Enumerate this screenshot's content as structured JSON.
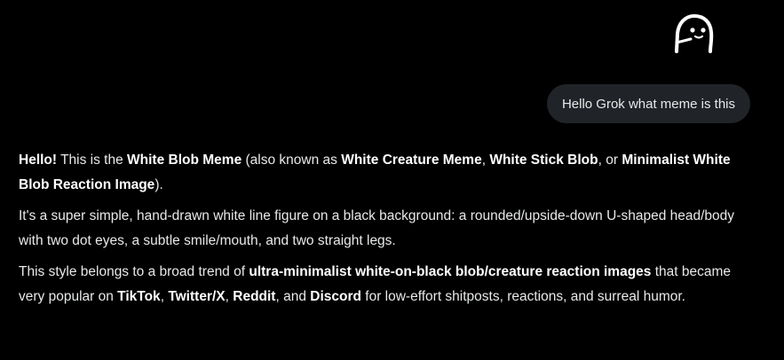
{
  "user": {
    "image": {
      "icon": "white-blob-creature-meme-icon"
    },
    "message": "Hello Grok what meme is this"
  },
  "assistant": {
    "p1": {
      "s1": "Hello!",
      "s2": " This is the ",
      "s3": "White Blob Meme",
      "s4": " (also known as ",
      "s5": "White Creature Meme",
      "s6": ", ",
      "s7": "White Stick Blob",
      "s8": ", or ",
      "s9": "Minimalist White Blob Reaction Image",
      "s10": ")."
    },
    "p2": "It's a super simple, hand-drawn white line figure on a black background: a rounded/upside-down U-shaped head/body with two dot eyes, a subtle smile/mouth, and two straight legs.",
    "p3": {
      "s1": "This style belongs to a broad trend of ",
      "s2": "ultra-minimalist white-on-black blob/creature reaction images",
      "s3": " that became very popular on ",
      "s4": "TikTok",
      "s5": ", ",
      "s6": "Twitter/X",
      "s7": ", ",
      "s8": "Reddit",
      "s9": ", and ",
      "s10": "Discord",
      "s11": " for low-effort shitposts, reactions, and surreal humor."
    }
  },
  "colors": {
    "background": "#000000",
    "user_bubble": "#202327",
    "text": "#e7e9ea",
    "bold_text": "#ffffff"
  }
}
